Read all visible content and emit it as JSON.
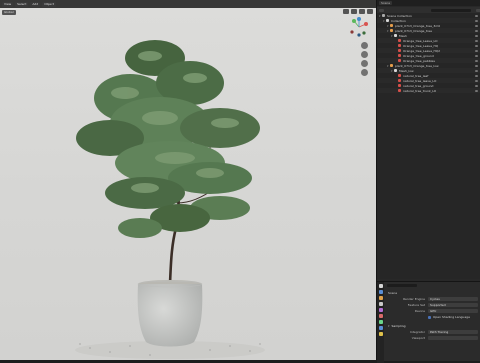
{
  "viewport": {
    "toolbar": [
      "View",
      "Select",
      "Add",
      "Object"
    ],
    "toolbar2": [
      "Global"
    ],
    "gizmo_labels": {
      "x": "X",
      "y": "Y",
      "z": "Z"
    }
  },
  "topbar": {
    "chips": [
      "Scene"
    ]
  },
  "outliner": {
    "search_placeholder": "",
    "rows": [
      {
        "indent": 0,
        "icon": "scene",
        "label": "Scene Collection"
      },
      {
        "indent": 1,
        "icon": "coll",
        "label": "Collection"
      },
      {
        "indent": 2,
        "icon": "mesh",
        "label": "plant_0713_Orange_tree_3m0"
      },
      {
        "indent": 2,
        "icon": "mesh",
        "label": "plant_0713_Orange_tree"
      },
      {
        "indent": 3,
        "icon": "coll",
        "label": "Mesh"
      },
      {
        "indent": 4,
        "icon": "mat",
        "label": "Orange_tree_Leave_LO"
      },
      {
        "indent": 4,
        "icon": "mat",
        "label": "Orange_tree_Leave_HQ"
      },
      {
        "indent": 4,
        "icon": "mat",
        "label": "Orange_tree_Leave_HQ2"
      },
      {
        "indent": 4,
        "icon": "mat",
        "label": "Orange_tree_ground"
      },
      {
        "indent": 4,
        "icon": "mat",
        "label": "Orange_tree_pebbles"
      },
      {
        "indent": 2,
        "icon": "mesh",
        "label": "plant_0713_Orange_tree_low"
      },
      {
        "indent": 3,
        "icon": "coll",
        "label": "Mesh_low"
      },
      {
        "indent": 4,
        "icon": "mat",
        "label": "natural_tree_leaf"
      },
      {
        "indent": 4,
        "icon": "mat",
        "label": "natural_tree_leave_LO"
      },
      {
        "indent": 4,
        "icon": "mat",
        "label": "natural_tree_ground"
      },
      {
        "indent": 4,
        "icon": "mat",
        "label": "natural_tree_trunk_LO"
      }
    ]
  },
  "properties": {
    "header": "Scene",
    "fields": [
      {
        "label": "Render Engine",
        "value": "Cycles"
      },
      {
        "label": "Feature Set",
        "value": "Supported"
      },
      {
        "label": "Device",
        "value": "GPU"
      }
    ],
    "checkbox": "Open Shading Language",
    "section": "Sampling",
    "fields2": [
      {
        "label": "Integrator",
        "value": "Path Tracing"
      },
      {
        "label": "Viewport",
        "value": ""
      }
    ],
    "tab_colors": [
      "#d6d6d6",
      "#5a8ed6",
      "#e0a24b",
      "#c9c9c9",
      "#b36fd6",
      "#d96a6a",
      "#6ad68a",
      "#5a8ed6",
      "#e0c24b"
    ]
  },
  "colors": {
    "foliage_dark": "#3f5c3c",
    "foliage_light": "#6f8f66",
    "pot": "#c8c9c7",
    "trunk": "#3b2e27"
  }
}
